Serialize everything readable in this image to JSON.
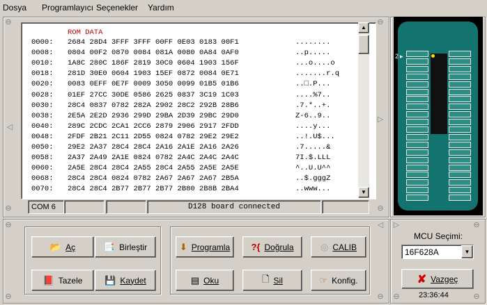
{
  "menu": [
    {
      "label": "Dosya"
    },
    {
      "label": "Programlayıcı"
    },
    {
      "label": "Seçenekler"
    },
    {
      "label": "Yardım"
    }
  ],
  "hex": {
    "title": "ROM DATA",
    "rows": [
      {
        "addr": "0000:",
        "words": "2684 28D4 3FFF 3FFF 00FF 0E03 0183 00F1",
        "ascii": "........"
      },
      {
        "addr": "0008:",
        "words": "0804 00F2 0870 0084 081A 0080 0A84 0AF0",
        "ascii": "..p....."
      },
      {
        "addr": "0010:",
        "words": "1A8C 280C 186F 2819 30C0 0604 1903 156F",
        "ascii": "...o....o"
      },
      {
        "addr": "0018:",
        "words": "281D 30E0 0604 1903 15EF 0872 0084 0E71",
        "ascii": ".......r.q"
      },
      {
        "addr": "0020:",
        "words": "0083 0EFF 0E7F 0009 3050 0099 01B5 01B6",
        "ascii": "..□.P..."
      },
      {
        "addr": "0028:",
        "words": "01EF 27CC 30DE 0586 2625 0837 3C19 1C03",
        "ascii": "....%7.."
      },
      {
        "addr": "0030:",
        "words": "28C4 0837 0782 282A 2902 28C2 292B 28B6",
        "ascii": ".7.*..+."
      },
      {
        "addr": "0038:",
        "words": "2E5A 2E2D 2936 299D 29BA 2D39 29BC 29D0",
        "ascii": "Z-6..9.."
      },
      {
        "addr": "0040:",
        "words": "289C 2CDC 2CA1 2CC6 2879 2906 2917 2FDD",
        "ascii": "....y..."
      },
      {
        "addr": "0048:",
        "words": "2FDF 2B21 2C11 2D55 0824 0782 29E2 29E2",
        "ascii": "..!.U$..."
      },
      {
        "addr": "0050:",
        "words": "29E2 2A37 28C4 28C4 2A16 2A1E 2A16 2A26",
        "ascii": ".7.....&"
      },
      {
        "addr": "0058:",
        "words": "2A37 2A49 2A1E 0824 0782 2A4C 2A4C 2A4C",
        "ascii": "7I.$.LLL"
      },
      {
        "addr": "0060:",
        "words": "2A5E 28C4 28C4 2A55 28C4 2A55 2A5E 2A5E",
        "ascii": "^..U.U^^"
      },
      {
        "addr": "0068:",
        "words": "28C4 28C4 0824 0782 2A67 2A67 2A67 2B5A",
        "ascii": "..$.gggZ"
      },
      {
        "addr": "0070:",
        "words": "28C4 28C4 2B77 2B77 2B77 2B80 2B8B 2BA4",
        "ascii": "..www..."
      }
    ]
  },
  "status": {
    "port": "COM 6",
    "message": "D128 board connected"
  },
  "chip": {
    "pin_marker": "2"
  },
  "buttons": {
    "open": "Aç",
    "merge": "Birleştir",
    "refresh": "Tazele",
    "save": "Kaydet",
    "program": "Programla",
    "verify": "Doğrula",
    "calib": "CALIB",
    "read": "Oku",
    "erase": "Sil",
    "config": "Konfig.",
    "cancel": "Vazgeç"
  },
  "mcu": {
    "label": "MCU Seçimi:",
    "selected": "16F628A"
  },
  "clock": "23:36:44",
  "colors": {
    "window_bg": "#d4d0c8",
    "board": "#13736e",
    "rom_title": "#c00000",
    "pin_marker": "#ffe000"
  }
}
